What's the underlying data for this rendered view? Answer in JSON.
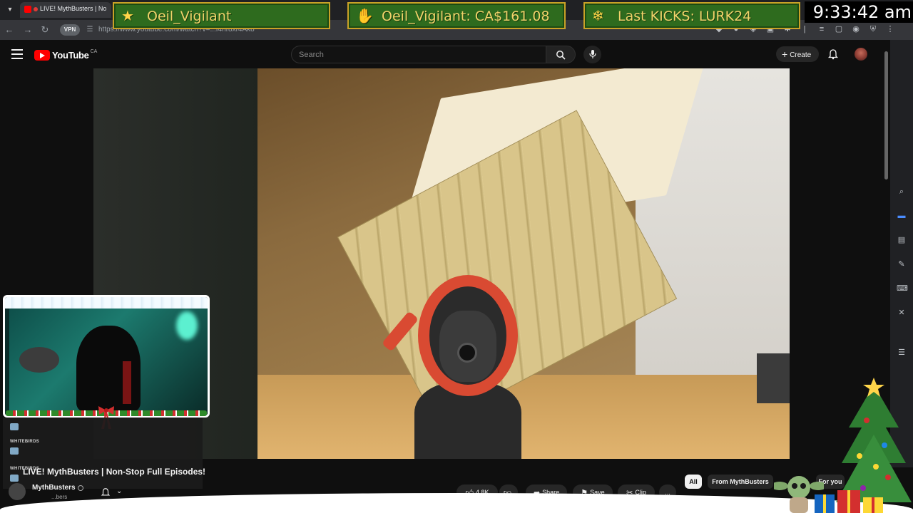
{
  "browser": {
    "tab_title": "LIVE! MythBusters | No",
    "url": "https://www.youtube.com/watch?v=...f4nr8xr4Ak8"
  },
  "overlay": {
    "banners": [
      {
        "icon": "star-icon",
        "text": "Oeil_Vigilant"
      },
      {
        "icon": "donation-icon",
        "text": "Oeil_Vigilant: CA$161.08"
      },
      {
        "icon": "kick-icon",
        "text": "Last KICKS: LURK24"
      }
    ],
    "clock": "9:33:42 am",
    "chat": [
      {
        "user": "WHITEBIRDS"
      },
      {
        "user": "WHITEBIRDS"
      }
    ]
  },
  "youtube": {
    "logo_text": "YouTube",
    "country": "CA",
    "search_placeholder": "Search",
    "create_label": "Create",
    "video_title": "LIVE! MythBusters | Non-Stop Full Episodes!",
    "channel_name": "MythBusters",
    "channel_subtext": "...bers",
    "actions": {
      "likes": "4.8K",
      "share": "Share",
      "save": "Save",
      "clip": "Clip",
      "more": "..."
    },
    "chips": [
      "All",
      "From MythBusters",
      "For you"
    ]
  }
}
